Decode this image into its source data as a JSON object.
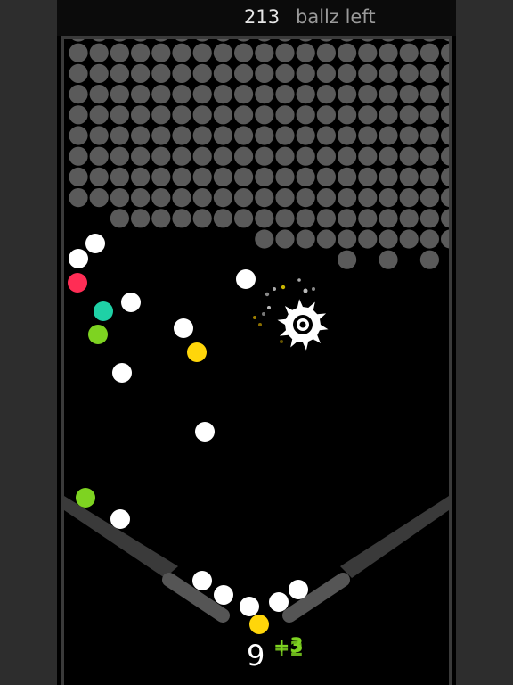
{
  "header": {
    "score": "213",
    "balls_left_label": "ballz left"
  },
  "footer": {
    "ball_count": "9",
    "bonus_top": "+3",
    "bonus_bottom": "+2"
  },
  "colors": {
    "block": "#5a5a5a",
    "ball": "#ffffff",
    "red": "#ff2d55",
    "teal": "#1fd1a6",
    "green": "#7ed321",
    "yellow": "#ffd60a",
    "wall": "#3a3a3a"
  },
  "icons": [
    "gear-obstacle-icon"
  ]
}
